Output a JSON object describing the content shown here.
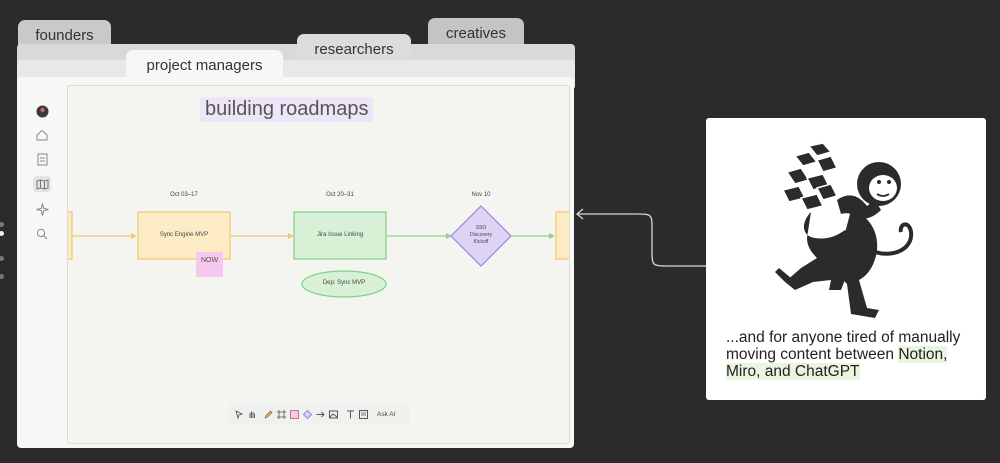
{
  "tabs": {
    "founders": "founders",
    "creatives": "creatives",
    "researchers": "researchers",
    "project_managers": "project managers"
  },
  "board": {
    "title": "building roadmaps",
    "milestones": [
      {
        "date": "Oct 03–17",
        "label": "Sync Engine MVP"
      },
      {
        "date": "Oct 20–31",
        "label": "Jira Issue Linking"
      },
      {
        "date": "Nov 10",
        "label": "SSO Discovery Kickoff"
      }
    ],
    "sticky_note": "NOW",
    "dependency": "Dep: Sync MVP",
    "toolbar": {
      "ask_ai": "Ask AI",
      "tools": [
        "cursor-icon",
        "hand-icon",
        "pencil-icon",
        "frame-icon",
        "sticky-icon",
        "diamond-icon",
        "arrow-icon",
        "image-icon",
        "text-icon",
        "note-icon"
      ]
    }
  },
  "sidebar": {
    "icons": [
      "logo-icon",
      "home-icon",
      "document-icon",
      "map-icon",
      "sparkle-icon",
      "search-icon"
    ]
  },
  "card": {
    "text_plain": "...and for anyone tired of manually moving content between ",
    "text_hl1": "Notion,",
    "text_hl2": "Miro, and ChatGPT"
  },
  "colors": {
    "background": "#2b2b2b",
    "sync_fill": "#fcebc5",
    "jira_fill": "#d8f0d6",
    "sso_fill": "#ddd3f5",
    "title_highlight": "#ece6f8",
    "sticky": "#f6c8ee"
  }
}
